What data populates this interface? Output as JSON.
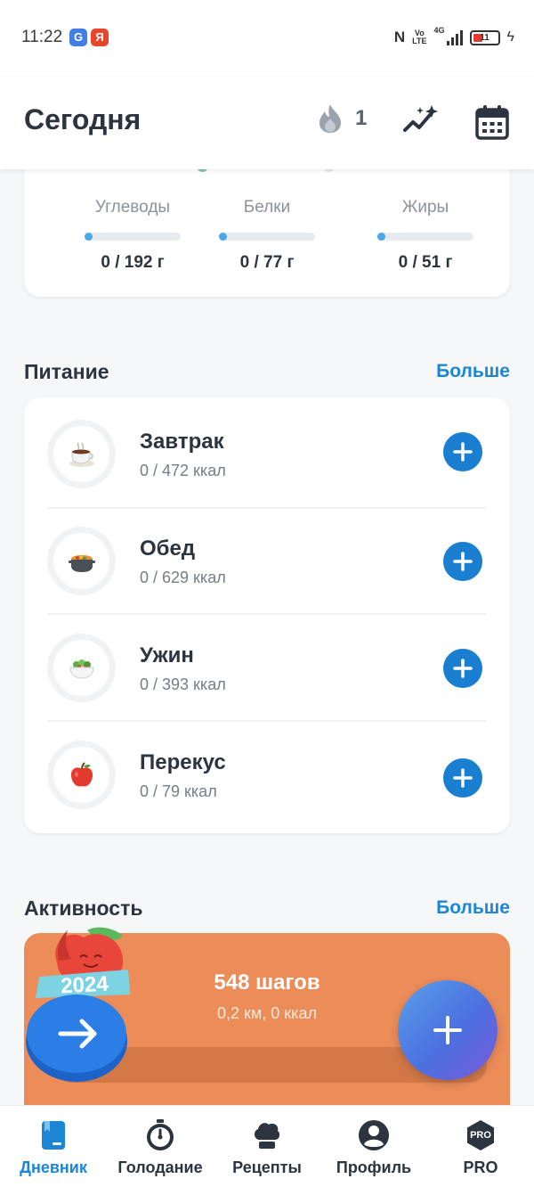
{
  "status_bar": {
    "time": "11:22",
    "app_icons": [
      {
        "name": "browser-app-icon",
        "glyph": "G"
      },
      {
        "name": "yandex-app-icon",
        "glyph": "Я"
      }
    ],
    "network_label": "4G",
    "volte_label": "Vo\nLTE",
    "battery_text": "11",
    "battery_color": "#e53935"
  },
  "header": {
    "title": "Сегодня",
    "streak_count": "1",
    "accent": "#1c86d4"
  },
  "macros": [
    {
      "label": "Углеводы",
      "value": "0 / 192 г",
      "progress": 0
    },
    {
      "label": "Белки",
      "value": "0 / 77 г",
      "progress": 0
    },
    {
      "label": "Жиры",
      "value": "0 / 51 г",
      "progress": 0
    }
  ],
  "nutrition": {
    "title": "Питание",
    "more_label": "Больше",
    "meals": [
      {
        "name": "Завтрак",
        "kcal": "0 / 472 ккал",
        "icon": "coffee-cup-icon"
      },
      {
        "name": "Обед",
        "kcal": "0 / 629 ккал",
        "icon": "soup-pot-icon"
      },
      {
        "name": "Ужин",
        "kcal": "0 / 393 ккал",
        "icon": "salad-bowl-icon"
      },
      {
        "name": "Перекус",
        "kcal": "0 / 79 ккал",
        "icon": "apple-icon"
      }
    ]
  },
  "activity": {
    "title": "Активность",
    "more_label": "Больше",
    "steps": "548 шагов",
    "details": "0,2 км, 0 ккал",
    "card_color": "#eb8c59",
    "promo_year": "2024"
  },
  "bottom_nav": [
    {
      "label": "Дневник",
      "icon": "diary-icon",
      "active": true
    },
    {
      "label": "Голодание",
      "icon": "stopwatch-icon",
      "active": false
    },
    {
      "label": "Рецепты",
      "icon": "chef-hat-icon",
      "active": false
    },
    {
      "label": "Профиль",
      "icon": "profile-icon",
      "active": false
    },
    {
      "label": "PRO",
      "icon": "pro-badge-icon",
      "badge": "PRO",
      "active": false
    }
  ]
}
